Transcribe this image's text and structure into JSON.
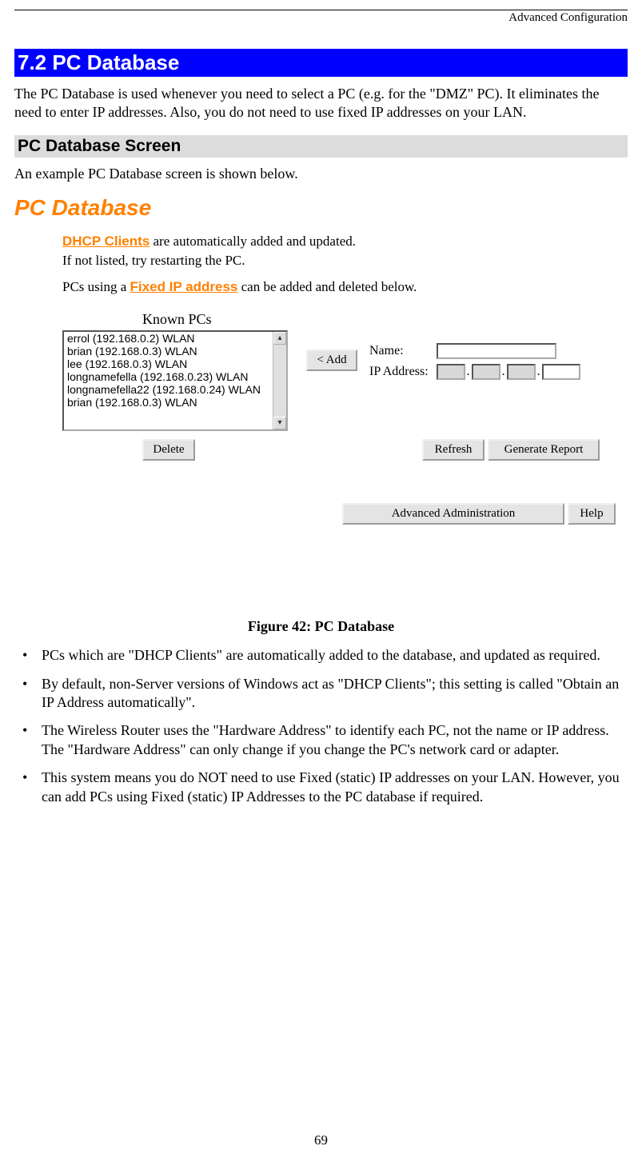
{
  "header": {
    "breadcrumb": "Advanced Configuration"
  },
  "section": {
    "heading": "7.2 PC Database",
    "intro": "The PC Database is used whenever you need to select a PC (e.g. for the \"DMZ\" PC). It eliminates the need to enter IP addresses. Also, you do not need to use fixed IP addresses on your LAN.",
    "subheading": "PC Database Screen",
    "example_text": "An example PC Database screen is shown below."
  },
  "ui": {
    "title": "PC Database",
    "info": {
      "dhcp_label": "DHCP Clients",
      "dhcp_rest": " are automatically added and updated.",
      "restart": "If not listed, try restarting the PC.",
      "fixed_pre": "PCs using a ",
      "fixed_label": "Fixed IP address",
      "fixed_post": " can be added and deleted below."
    },
    "known_label": "Known PCs",
    "list_items": [
      "errol (192.168.0.2) WLAN",
      "brian (192.168.0.3) WLAN",
      "lee (192.168.0.3) WLAN",
      "longnamefella (192.168.0.23) WLAN",
      "longnamefella22 (192.168.0.24) WLAN",
      "brian (192.168.0.3) WLAN"
    ],
    "buttons": {
      "add": "< Add",
      "delete": "Delete",
      "refresh": "Refresh",
      "generate": "Generate Report",
      "advadmin": "Advanced Administration",
      "help": "Help"
    },
    "form": {
      "name_label": "Name:",
      "ip_label": "IP Address:"
    }
  },
  "figure_caption": "Figure 42: PC Database",
  "bullets": [
    "PCs which are \"DHCP Clients\" are automatically added to the database, and updated as required.",
    "By default, non-Server versions of Windows act as \"DHCP Clients\"; this setting is called \"Obtain an IP Address automatically\".",
    "The Wireless Router uses the \"Hardware Address\" to identify each PC, not the name or IP address. The \"Hardware Address\" can only change if you change the PC's network card or adapter.",
    "This system means you do NOT need to use Fixed (static) IP addresses on your LAN. However, you can add PCs using Fixed (static) IP Addresses to the PC database if required."
  ],
  "page_number": "69"
}
